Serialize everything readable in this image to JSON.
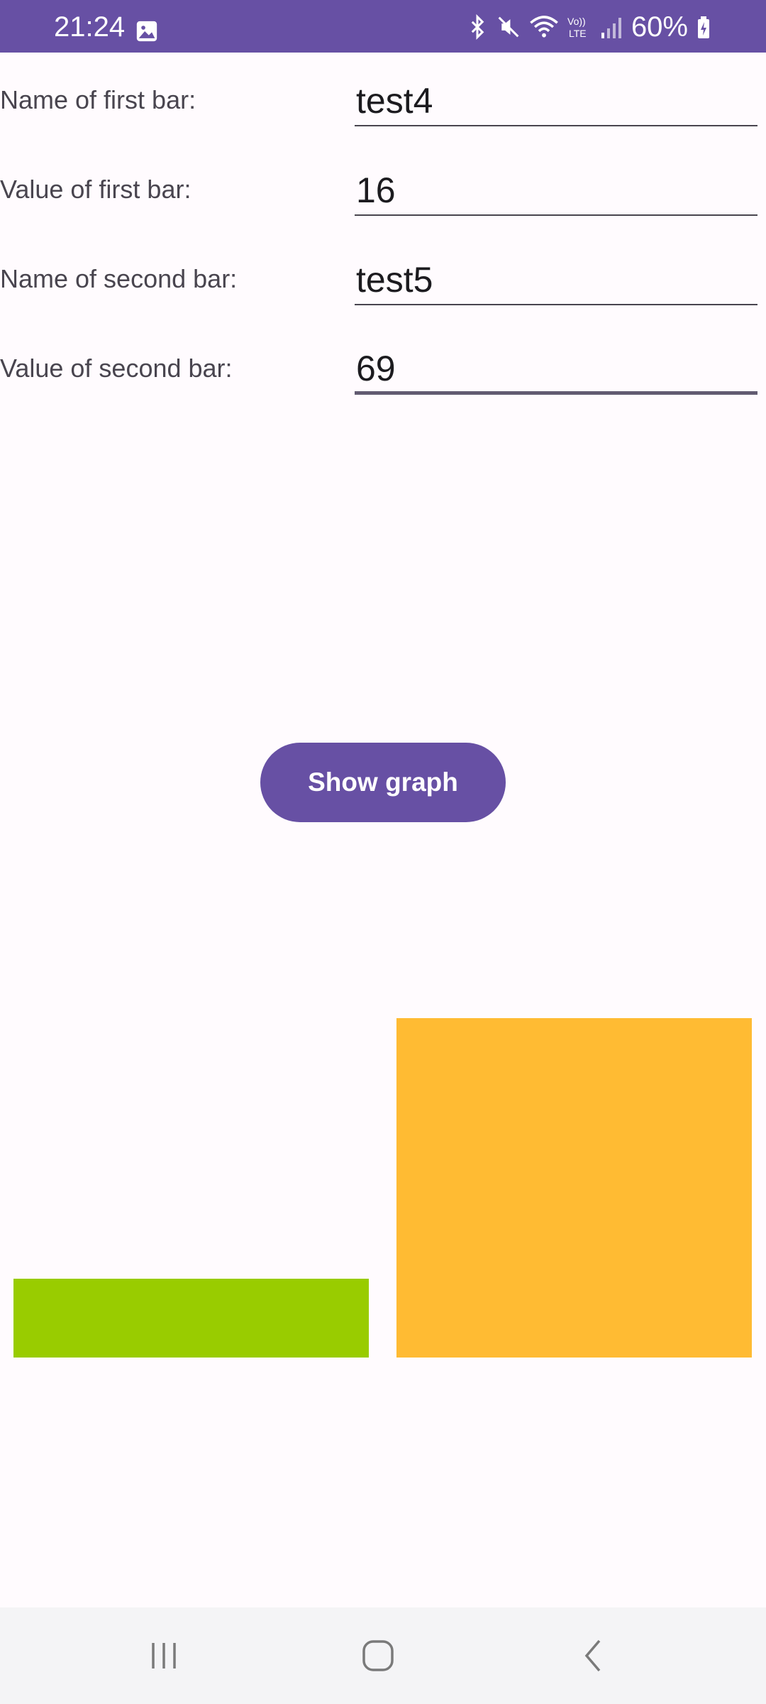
{
  "status_bar": {
    "time": "21:24",
    "battery": "60%",
    "icons": [
      "gallery-icon",
      "bluetooth-icon",
      "mute-icon",
      "wifi-icon",
      "volte-icon",
      "signal-icon",
      "battery-charging-icon"
    ],
    "volte_text": "Vo)) LTE",
    "color": "#6750a4"
  },
  "form": {
    "first_name_label": "Name of first bar:",
    "first_name_value": "test4",
    "first_value_label": "Value of first bar:",
    "first_value_value": "16",
    "second_name_label": "Name of second bar:",
    "second_name_value": "test5",
    "second_value_label": "Value of second bar:",
    "second_value_value": "69"
  },
  "button": {
    "label": "Show graph",
    "color": "#6750a4"
  },
  "chart_data": {
    "type": "bar",
    "categories": [
      "test4",
      "test5"
    ],
    "values": [
      16,
      69
    ],
    "colors": [
      "#99cc00",
      "#ffbb33"
    ],
    "ylim": [
      0,
      69
    ]
  },
  "nav_bar": {
    "icons": [
      "recents-icon",
      "home-icon",
      "back-icon"
    ]
  }
}
